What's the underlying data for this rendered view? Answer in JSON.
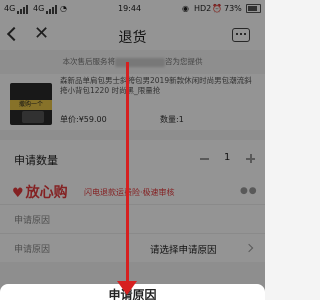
{
  "status_bar": {
    "net1": "4G",
    "net2": "4G",
    "time": "19:44",
    "hd": "HD2",
    "battery": "73%"
  },
  "nav": {
    "title": "退货"
  },
  "notice": {
    "left": "本次售后服务将",
    "right": "咨为您提供"
  },
  "product": {
    "badge": "撒购一个",
    "name": "森新品单肩包男士斜挎包男2019新款休闲时尚男包潮流斜挎小背包1220 时尚黑_限量抢",
    "unit_price": "单价:¥59.00",
    "quantity": "数量:1"
  },
  "quantity_row": {
    "label": "申请数量",
    "value": "1"
  },
  "assurance": {
    "logo": "放心购",
    "text": "闪电退款运费险·极速审核"
  },
  "reason": {
    "label": "申请原因",
    "placeholder": "请选择申请原因"
  },
  "sheet": {
    "title": "申请原因"
  },
  "colors": {
    "accent": "#e4393c",
    "arrow": "#d62020"
  }
}
